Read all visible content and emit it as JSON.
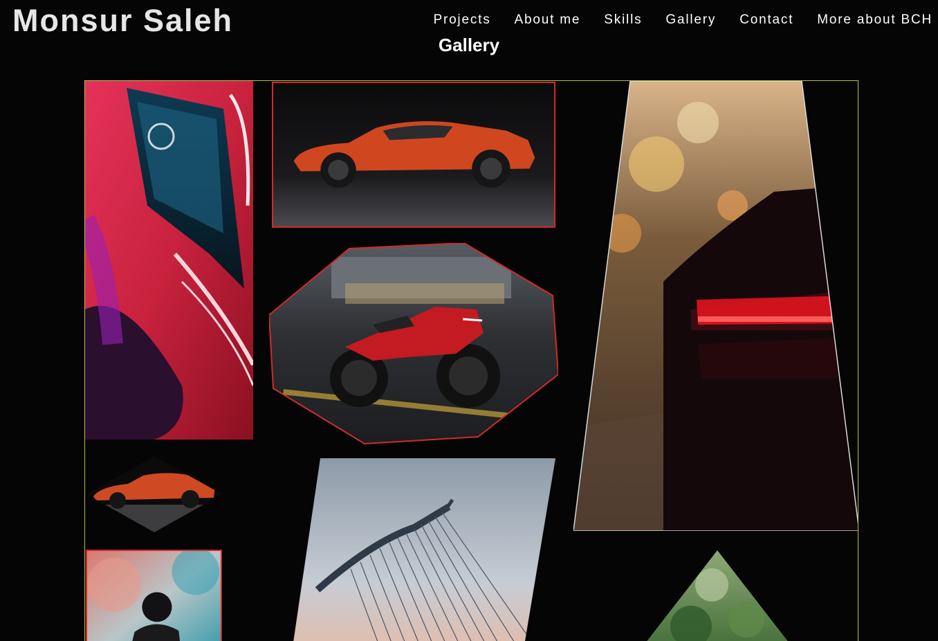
{
  "header": {
    "brand": "Monsur Saleh",
    "nav": [
      {
        "label": "Projects"
      },
      {
        "label": "About me"
      },
      {
        "label": "Skills"
      },
      {
        "label": "Gallery"
      },
      {
        "label": "Contact"
      },
      {
        "label": "More about BCH"
      }
    ]
  },
  "page": {
    "title": "Gallery"
  },
  "colors": {
    "background": "#050505",
    "accent_red": "#d42a2a",
    "frame_border": "#b5c24a"
  },
  "gallery": {
    "images": [
      {
        "subject": "red-vintage-car-closeup"
      },
      {
        "subject": "orange-sports-car-side"
      },
      {
        "subject": "red-motorcycle-parking-garage"
      },
      {
        "subject": "red-sports-car-rear-lights"
      },
      {
        "subject": "orange-sports-car-small"
      },
      {
        "subject": "cable-stayed-bridge"
      },
      {
        "subject": "motorcyclist-colored-smoke"
      },
      {
        "subject": "green-foliage-triangle"
      }
    ]
  }
}
